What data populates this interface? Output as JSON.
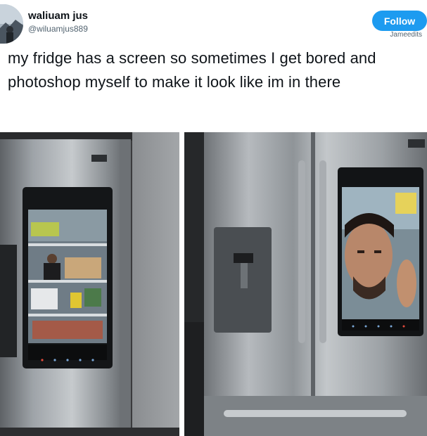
{
  "tweet": {
    "display_name": "waliuam jus",
    "handle": "@wiluamjus889",
    "follow_label": "Follow",
    "watermark": "Jameedits",
    "text": "my fridge has a screen so sometimes I get bored and photoshop myself to make it look like im in there"
  },
  "media": {
    "photo_left_icon": "fridge-photo-icon",
    "photo_right_icon": "fridge-photo-icon"
  },
  "colors": {
    "accent": "#1d9bf0",
    "text": "#0f1419",
    "secondary_text": "#536471"
  }
}
